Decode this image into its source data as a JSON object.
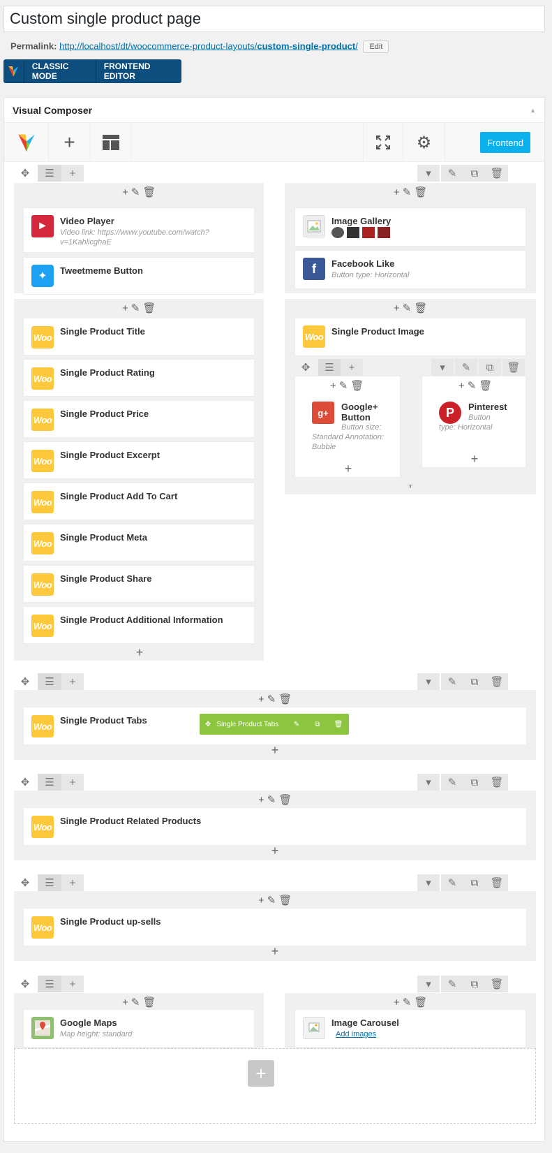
{
  "page": {
    "title": "Custom single product page",
    "permalink_label": "Permalink:",
    "permalink_url": "http://localhost/dt/woocommerce-product-layouts/",
    "permalink_slug": "custom-single-product",
    "permalink_end": "/",
    "edit_label": "Edit"
  },
  "mode": {
    "classic": "CLASSIC MODE",
    "frontend_editor": "FRONTEND EDITOR"
  },
  "panel": {
    "title": "Visual Composer",
    "frontend_button": "Frontend"
  },
  "row1": {
    "left_top": [
      {
        "name": "Video Player",
        "sub": "Video link: https://www.youtube.com/watch?v=1KahlicghaE",
        "icon": "video-icon"
      },
      {
        "name": "Tweetmeme Button",
        "icon": "twitter-icon"
      }
    ],
    "left_bottom": [
      "Single Product Title",
      "Single Product Rating",
      "Single Product Price",
      "Single Product Excerpt",
      "Single Product Add To Cart",
      "Single Product Meta",
      "Single Product Share",
      "Single Product Additional Information"
    ],
    "right_top": [
      {
        "name": "Image Gallery",
        "icon": "gallery-icon"
      },
      {
        "name": "Facebook Like",
        "sub": "Button type: Horizontal",
        "icon": "facebook-icon"
      }
    ],
    "right_bottom_elem": "Single Product Image",
    "inner_left": {
      "name1": "Google+",
      "name2": "Button",
      "sub": "Button size: Standard  Annotation: Bubble"
    },
    "inner_right": {
      "name": "Pinterest",
      "sub": "Button type: Horizontal"
    }
  },
  "row2": {
    "elem": "Single Product Tabs",
    "drag_label": "Single Product Tabs"
  },
  "row3": {
    "elem": "Single Product Related Products"
  },
  "row4": {
    "elem": "Single Product up-sells"
  },
  "row5": {
    "left": {
      "name": "Google Maps",
      "sub": "Map height: standard"
    },
    "right": {
      "name": "Image Carousel",
      "link": "Add images"
    }
  },
  "woo_label": "Woo",
  "colors": {
    "woo": "#fdc83b",
    "frontend": "#0ab1ec",
    "modebar": "#0d4e7e",
    "green": "#8cc63f"
  }
}
